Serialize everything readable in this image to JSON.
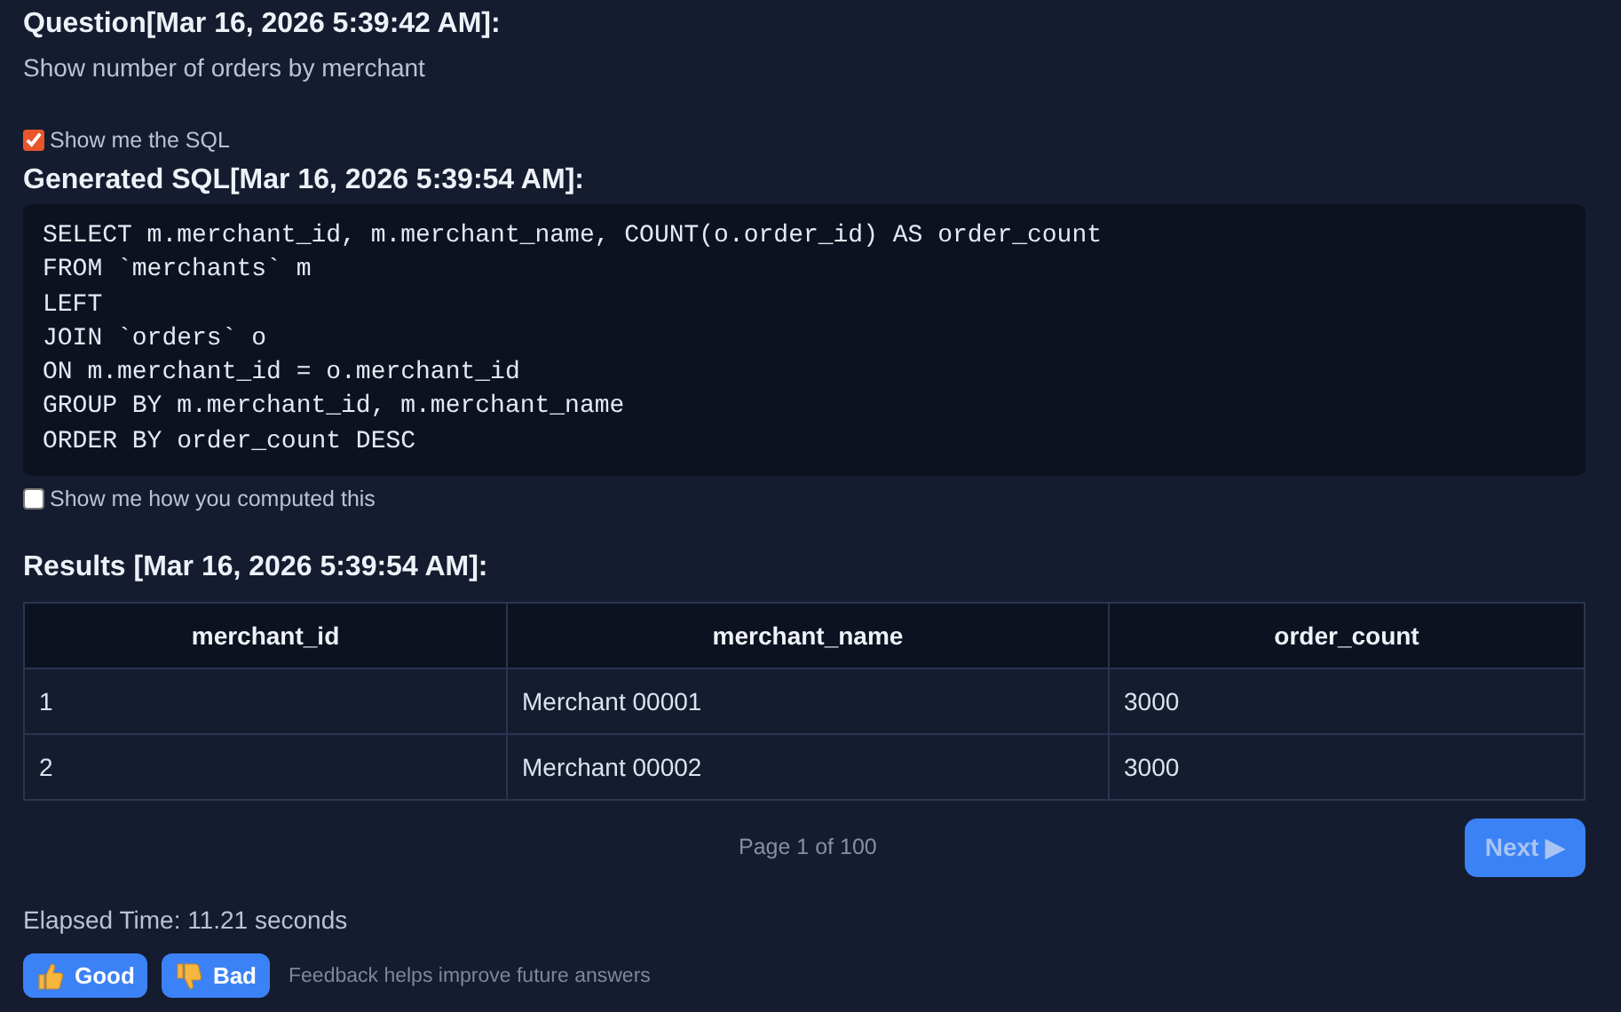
{
  "question": {
    "heading": "Question[Mar 16, 2026 5:39:42 AM]:",
    "text": "Show number of orders by merchant"
  },
  "show_sql": {
    "label": "Show me the SQL",
    "checked": true
  },
  "sql": {
    "heading": "Generated SQL[Mar 16, 2026 5:39:54 AM]:",
    "lines": [
      "SELECT m.merchant_id, m.merchant_name, COUNT(o.order_id) AS order_count",
      "FROM `merchants` m",
      "LEFT",
      "JOIN `orders` o",
      "ON m.merchant_id = o.merchant_id",
      "GROUP BY m.merchant_id, m.merchant_name",
      "ORDER BY order_count DESC"
    ]
  },
  "show_computation": {
    "label": "Show me how you computed this",
    "checked": false
  },
  "results": {
    "heading": "Results [Mar 16, 2026 5:39:54 AM]:",
    "columns": [
      "merchant_id",
      "merchant_name",
      "order_count"
    ],
    "rows": [
      [
        "1",
        "Merchant 00001",
        "3000"
      ],
      [
        "2",
        "Merchant 00002",
        "3000"
      ]
    ]
  },
  "pagination": {
    "label": "Page 1 of 100",
    "next": {
      "label": "Next ▶",
      "disabled": true
    }
  },
  "elapsed": "Elapsed Time: 11.21 seconds",
  "feedback": {
    "buttons": [
      {
        "kind": "up",
        "label": "Good"
      },
      {
        "kind": "down",
        "label": "Bad"
      }
    ],
    "hint": "Feedback helps improve future answers"
  }
}
